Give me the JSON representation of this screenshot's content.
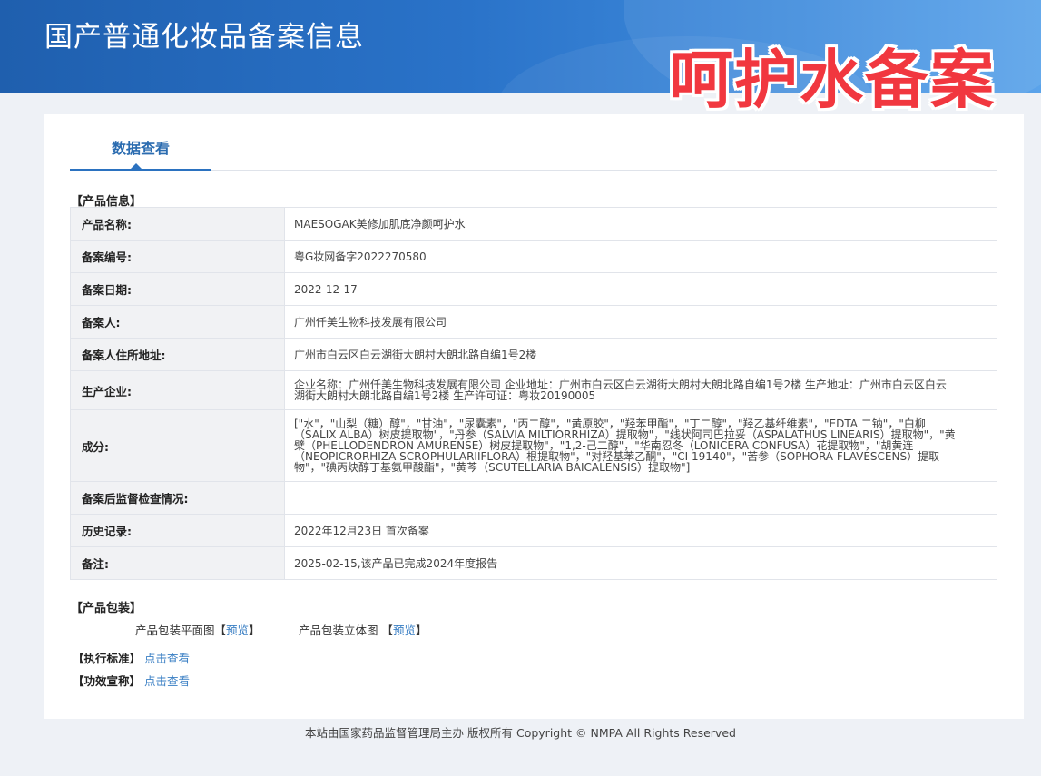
{
  "header": {
    "site_title": "国产普通化妆品备案信息",
    "watermark": "呵护水备案"
  },
  "tab": {
    "label": "数据查看"
  },
  "product_info": {
    "section_title": "【产品信息】",
    "rows": [
      {
        "label": "产品名称:",
        "value": "MAESOGAK美修加肌底净颜呵护水"
      },
      {
        "label": "备案编号:",
        "value": "粤G妆网备字2022270580"
      },
      {
        "label": "备案日期:",
        "value": "2022-12-17"
      },
      {
        "label": "备案人:",
        "value": "广州仟美生物科技发展有限公司"
      },
      {
        "label": "备案人住所地址:",
        "value": "广州市白云区白云湖街大朗村大朗北路自编1号2楼"
      },
      {
        "label": "生产企业:",
        "value": "企业名称：广州仟美生物科技发展有限公司 企业地址：广州市白云区白云湖街大朗村大朗北路自编1号2楼 生产地址：广州市白云区白云湖街大朗村大朗北路自编1号2楼 生产许可证：粤妆20190005"
      },
      {
        "label": "成分:",
        "value": "[\"水\"，\"山梨（糖）醇\"，\"甘油\"，\"尿囊素\"，\"丙二醇\"，\"黄原胶\"，\"羟苯甲酯\"，\"丁二醇\"，\"羟乙基纤维素\"，\"EDTA 二钠\"，\"白柳（SALIX ALBA）树皮提取物\"，\"丹参（SALVIA MILTIORRHIZA）提取物\"，\"线状阿司巴拉妥（ASPALATHUS LINEARIS）提取物\"，\"黄檗（PHELLODENDRON AMURENSE）树皮提取物\"，\"1,2-己二醇\"，\"华南忍冬（LONICERA CONFUSA）花提取物\"，\"胡黄连（NEOPICRORHIZA SCROPHULARIIFLORA）根提取物\"，\"对羟基苯乙酮\"，\"CI 19140\"，\"苦参（SOPHORA FLAVESCENS）提取物\"，\"碘丙炔醇丁基氨甲酸酯\"，\"黄芩（SCUTELLARIA BAICALENSIS）提取物\"]"
      },
      {
        "label": "备案后监督检查情况:",
        "value": ""
      },
      {
        "label": "历史记录:",
        "value": "2022年12月23日 首次备案"
      },
      {
        "label": "备注:",
        "value": "2025-02-15,该产品已完成2024年度报告"
      }
    ]
  },
  "packaging": {
    "section_title": "【产品包装】",
    "flat_label": "产品包装平面图",
    "solid_label": "产品包装立体图",
    "bracket_open": "【",
    "bracket_close": "】",
    "preview": "预览"
  },
  "standard": {
    "label": "【执行标准】",
    "link": "点击查看"
  },
  "efficacy": {
    "label": "【功效宣称】",
    "link": "点击查看"
  },
  "footer": {
    "text": "本站由国家药品监督管理局主办 版权所有 Copyright © NMPA All Rights Reserved"
  }
}
